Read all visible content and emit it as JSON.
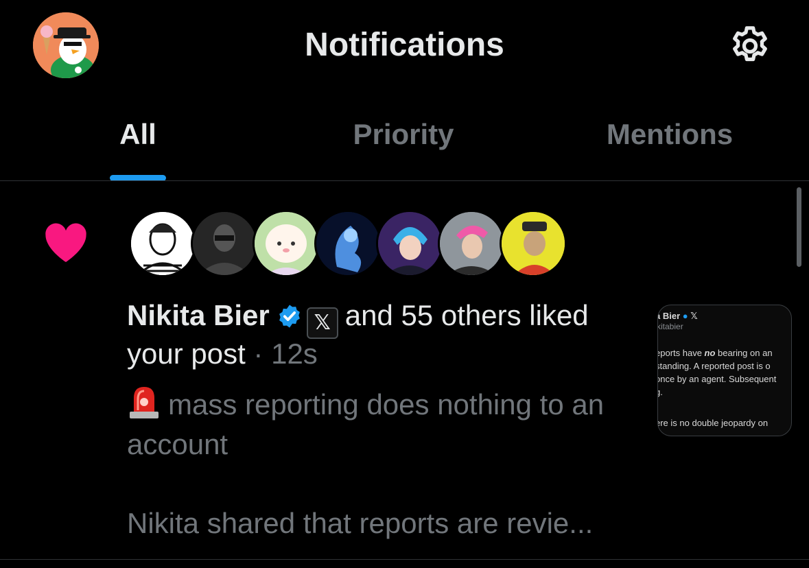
{
  "header": {
    "title": "Notifications",
    "avatar_icon": "user-avatar",
    "settings_icon": "gear-icon"
  },
  "tabs": [
    {
      "label": "All",
      "active": true
    },
    {
      "label": "Priority",
      "active": false
    },
    {
      "label": "Mentions",
      "active": false
    }
  ],
  "colors": {
    "accent": "#1d9bf0",
    "like": "#f91880",
    "background": "#000000",
    "muted_text": "#71767b"
  },
  "notification": {
    "type_icon": "heart-icon",
    "avatars_count": 7,
    "actor_name": "Nikita Bier",
    "actor_verified": true,
    "summary_suffix": "and 55 others liked",
    "summary_line2": "your post",
    "separator": " · ",
    "time": "12s",
    "post_text": "mass reporting does nothing to an account",
    "post_emoji": "rotating-light-icon",
    "post_more": "Nikita shared that reports are revie...",
    "preview": {
      "name": "a Bier",
      "handle": "kitabier",
      "line1_pre": "eports have ",
      "line1_bold": "no",
      "line1_post": " bearing on an",
      "line2": "standing. A reported post is o",
      "line3": "once by an agent. Subsequent",
      "line4": "g.",
      "line5": "ere is no double jeopardy on"
    }
  }
}
